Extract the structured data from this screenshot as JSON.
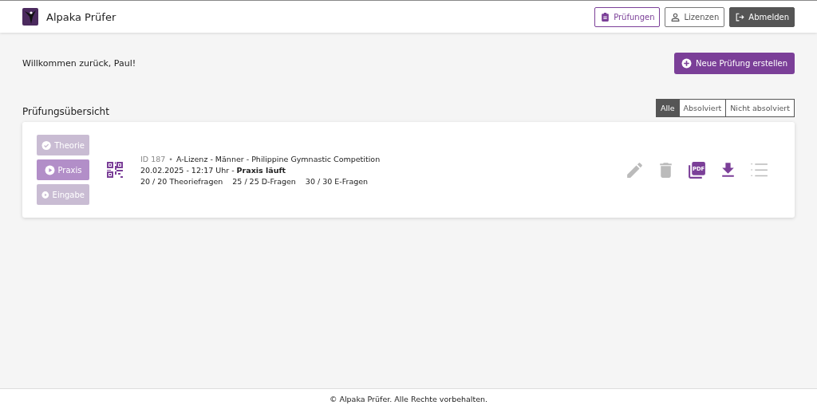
{
  "header": {
    "app_name": "Alpaka Prüfer",
    "nav": [
      {
        "label": "Prüfungen",
        "selected": true,
        "kind": "clipboard"
      },
      {
        "label": "Lizenzen",
        "selected": false,
        "kind": "person"
      }
    ],
    "logout": {
      "label": "Abmelden"
    }
  },
  "welcome": "Willkommen zurück, Paul!",
  "create_button": {
    "label": "Neue Prüfung erstellen"
  },
  "section_title": "Prüfungsübersicht",
  "filters": [
    {
      "label": "Alle",
      "selected": true
    },
    {
      "label": "Absolviert",
      "selected": false
    },
    {
      "label": "Nicht absolviert",
      "selected": false
    }
  ],
  "exams": [
    {
      "steps": [
        {
          "label": "Theorie",
          "kind": "check",
          "active": false
        },
        {
          "label": "Praxis",
          "kind": "play",
          "active": true
        },
        {
          "label": "Eingabe",
          "kind": "play",
          "active": false
        }
      ],
      "id": "ID 187",
      "bullet": "•",
      "title": "A-Lizenz - Männer - Philippine Gymnastic Competition",
      "status_line": "20.02.2025 - 12:17 Uhr - **Praxis läuft**",
      "counts": [
        "20 / 20 Theoriefragen",
        "25 / 25 D-Fragen",
        "30 / 30 E-Fragen"
      ],
      "actions": [
        {
          "kind": "edit",
          "disabled": true
        },
        {
          "kind": "delete",
          "disabled": true
        },
        {
          "kind": "pdf",
          "label": "PDF",
          "disabled": false
        },
        {
          "kind": "download",
          "disabled": false
        },
        {
          "kind": "list",
          "disabled": true
        }
      ]
    }
  ],
  "footer": "© Alpaka Prüfer. Alle Rechte vorbehalten."
}
